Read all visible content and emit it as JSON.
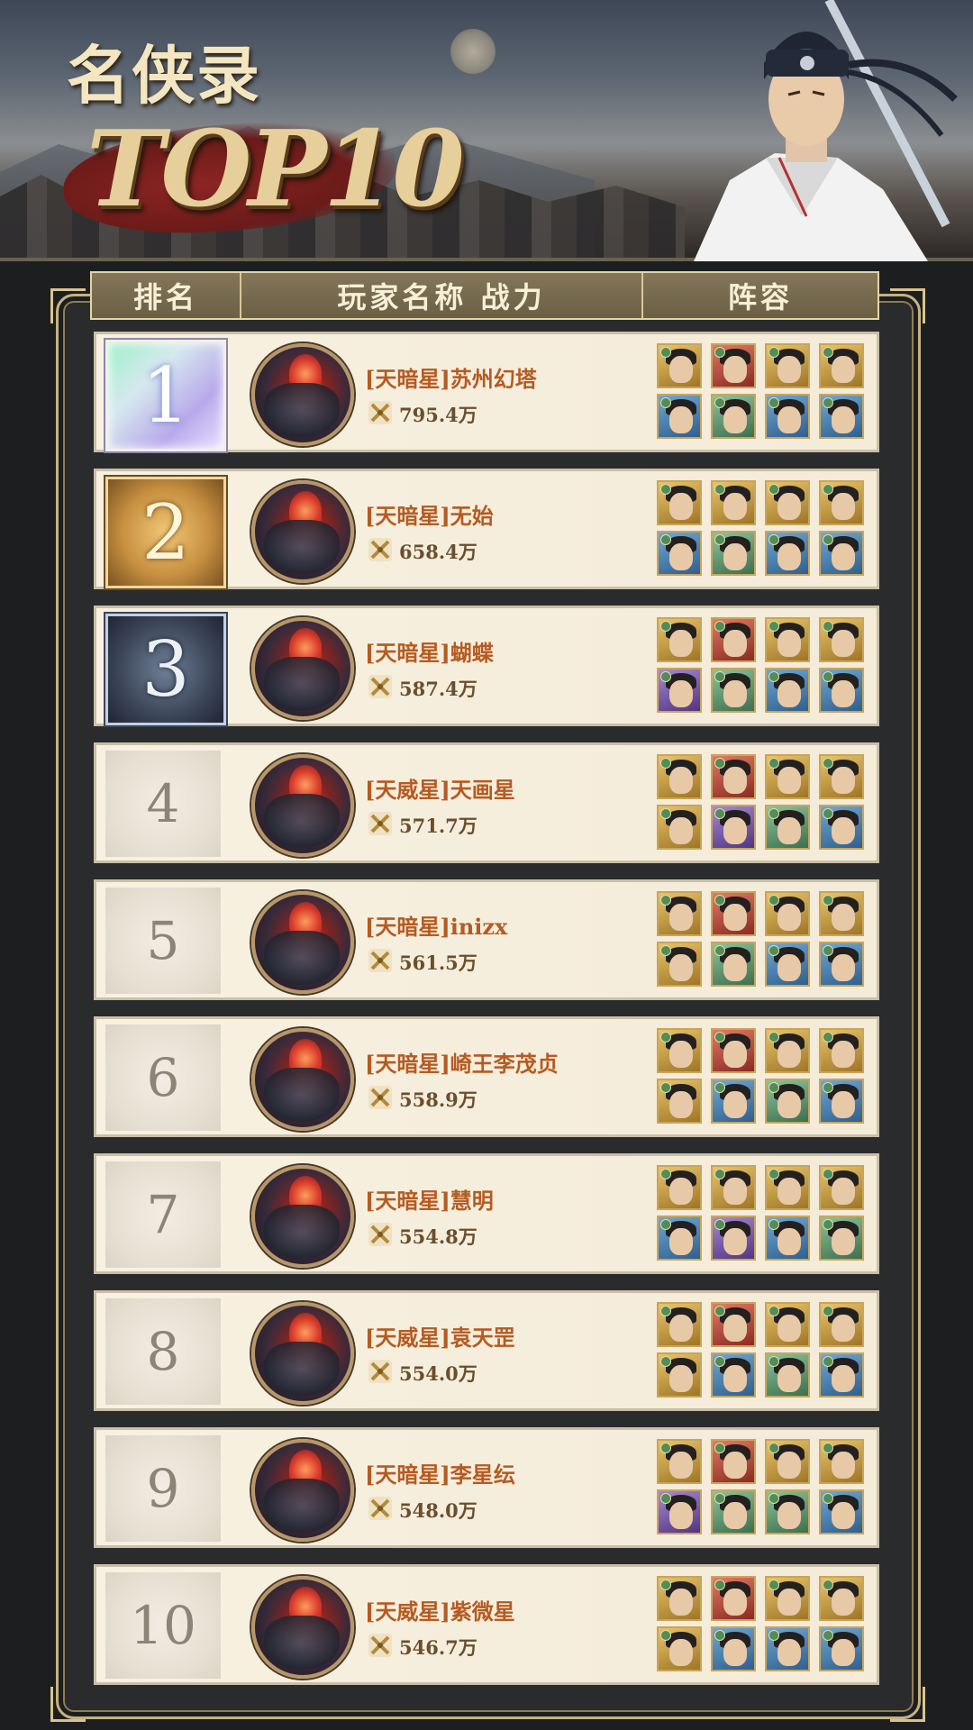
{
  "header": {
    "title_cn": "名侠录",
    "title_top": "TOP10"
  },
  "columns": {
    "rank": "排名",
    "name_power": "玩家名称 战力",
    "lineup": "阵容"
  },
  "rows": [
    {
      "rank": "1",
      "name": "[天暗星]苏州幻塔",
      "power": "795.4万",
      "lineup": [
        "bg-gold",
        "bg-red",
        "bg-gold",
        "bg-gold",
        "bg-blue",
        "bg-green",
        "bg-blue",
        "bg-blue"
      ]
    },
    {
      "rank": "2",
      "name": "[天暗星]无始",
      "power": "658.4万",
      "lineup": [
        "bg-gold",
        "bg-gold",
        "bg-gold",
        "bg-gold",
        "bg-blue",
        "bg-green",
        "bg-blue",
        "bg-blue"
      ]
    },
    {
      "rank": "3",
      "name": "[天暗星]蝴蝶",
      "power": "587.4万",
      "lineup": [
        "bg-gold",
        "bg-red",
        "bg-gold",
        "bg-gold",
        "bg-purple",
        "bg-green",
        "bg-blue",
        "bg-blue"
      ]
    },
    {
      "rank": "4",
      "name": "[天威星]天画星",
      "power": "571.7万",
      "lineup": [
        "bg-gold",
        "bg-red",
        "bg-gold",
        "bg-gold",
        "bg-gold",
        "bg-purple",
        "bg-green",
        "bg-blue"
      ]
    },
    {
      "rank": "5",
      "name": "[天暗星]inizx",
      "power": "561.5万",
      "lineup": [
        "bg-gold",
        "bg-red",
        "bg-gold",
        "bg-gold",
        "bg-gold",
        "bg-green",
        "bg-blue",
        "bg-blue"
      ]
    },
    {
      "rank": "6",
      "name": "[天暗星]崎王李茂贞",
      "power": "558.9万",
      "lineup": [
        "bg-gold",
        "bg-red",
        "bg-gold",
        "bg-gold",
        "bg-gold",
        "bg-blue",
        "bg-green",
        "bg-blue"
      ]
    },
    {
      "rank": "7",
      "name": "[天暗星]慧明",
      "power": "554.8万",
      "lineup": [
        "bg-gold",
        "bg-gold",
        "bg-gold",
        "bg-gold",
        "bg-blue",
        "bg-purple",
        "bg-blue",
        "bg-green"
      ]
    },
    {
      "rank": "8",
      "name": "[天威星]袁天罡",
      "power": "554.0万",
      "lineup": [
        "bg-gold",
        "bg-red",
        "bg-gold",
        "bg-gold",
        "bg-gold",
        "bg-blue",
        "bg-green",
        "bg-blue"
      ]
    },
    {
      "rank": "9",
      "name": "[天暗星]李星纭",
      "power": "548.0万",
      "lineup": [
        "bg-gold",
        "bg-red",
        "bg-gold",
        "bg-gold",
        "bg-purple",
        "bg-green",
        "bg-green",
        "bg-blue"
      ]
    },
    {
      "rank": "10",
      "name": "[天威星]紫微星",
      "power": "546.7万",
      "lineup": [
        "bg-gold",
        "bg-red",
        "bg-gold",
        "bg-gold",
        "bg-gold",
        "bg-blue",
        "bg-blue",
        "bg-blue"
      ]
    }
  ],
  "colors": {
    "name": "#b55b22",
    "power": "#6a4f2d",
    "frame_gold": "#c6b27e",
    "header_bar": "#7a6d50"
  },
  "icons": {
    "power": "crossed-swords-icon",
    "avatar": "player-avatar",
    "hero": "hero-portrait"
  }
}
